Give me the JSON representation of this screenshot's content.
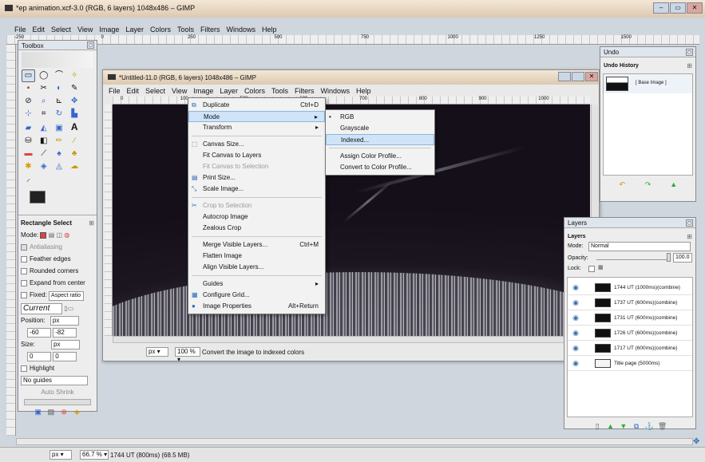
{
  "main_window": {
    "title": "*ep animation.xcf-3.0 (RGB, 6 layers) 1048x486 – GIMP",
    "menu": [
      "File",
      "Edit",
      "Select",
      "View",
      "Image",
      "Layer",
      "Colors",
      "Tools",
      "Filters",
      "Windows",
      "Help"
    ],
    "ruler_marks": [
      "-250",
      "0",
      "250",
      "500",
      "750",
      "1000",
      "1250",
      "1500"
    ],
    "status": {
      "unit": "px ▾",
      "zoom": "66.7 % ▾",
      "message": "1744 UT (800ms) (68.5 MB)"
    }
  },
  "toolbox": {
    "title": "Toolbox",
    "tool_options_title": "Rectangle Select",
    "mode_label": "Mode:",
    "antialiasing": "Antialiasing",
    "feather": "Feather edges",
    "rounded": "Rounded corners",
    "expand": "Expand from center",
    "fixed_label": "Fixed:",
    "fixed_value": "Aspect ratio",
    "current": "Current",
    "position_label": "Position:",
    "position_unit": "px",
    "pos_x": "-60",
    "pos_y": "-82",
    "size_label": "Size:",
    "size_unit": "px",
    "size_w": "0",
    "size_h": "0",
    "highlight": "Highlight",
    "guides": "No guides",
    "autoshrink": "Auto Shrink"
  },
  "untitled_window": {
    "title": "*Untitled-11.0 (RGB, 6 layers) 1048x486 – GIMP",
    "menu": [
      "File",
      "Edit",
      "Select",
      "View",
      "Image",
      "Layer",
      "Colors",
      "Tools",
      "Filters",
      "Windows",
      "Help"
    ],
    "ruler_marks": [
      "0",
      "100",
      "500",
      "600",
      "700",
      "800",
      "900",
      "1000"
    ],
    "status": {
      "unit": "px ▾",
      "zoom": "100 % ▾",
      "message": "Convert the image to indexed colors"
    }
  },
  "image_menu": {
    "items": [
      {
        "label": "Duplicate",
        "accel": "Ctrl+D",
        "icon": "duplicate-icon",
        "glyph": "⧉"
      },
      {
        "label": "Mode",
        "arrow": "▸",
        "highlight": true
      },
      {
        "label": "Transform",
        "arrow": "▸"
      },
      {
        "sep": true
      },
      {
        "label": "Canvas Size...",
        "icon": "canvas-size-icon",
        "glyph": "⬚"
      },
      {
        "label": "Fit Canvas to Layers"
      },
      {
        "label": "Fit Canvas to Selection",
        "disabled": true
      },
      {
        "label": "Print Size...",
        "icon": "print-size-icon",
        "glyph": "▤"
      },
      {
        "label": "Scale Image...",
        "icon": "scale-icon",
        "glyph": "⤡"
      },
      {
        "sep": true
      },
      {
        "label": "Crop to Selection",
        "disabled": true,
        "icon": "crop-icon",
        "glyph": "✂"
      },
      {
        "label": "Autocrop Image"
      },
      {
        "label": "Zealous Crop"
      },
      {
        "sep": true
      },
      {
        "label": "Merge Visible Layers...",
        "accel": "Ctrl+M"
      },
      {
        "label": "Flatten Image"
      },
      {
        "label": "Align Visible Layers..."
      },
      {
        "sep": true
      },
      {
        "label": "Guides",
        "arrow": "▸"
      },
      {
        "label": "Configure Grid...",
        "icon": "grid-icon",
        "glyph": "▦"
      },
      {
        "label": "Image Properties",
        "accel": "Alt+Return",
        "icon": "info-icon",
        "glyph": "●"
      }
    ]
  },
  "mode_submenu": {
    "items": [
      {
        "label": "RGB",
        "bullet": "•"
      },
      {
        "label": "Grayscale"
      },
      {
        "label": "Indexed...",
        "highlight": true
      },
      {
        "sep": true
      },
      {
        "label": "Assign Color Profile..."
      },
      {
        "label": "Convert to Color Profile..."
      }
    ]
  },
  "undo": {
    "title": "Undo",
    "history_label": "Undo History",
    "base_image": "[ Base Image ]"
  },
  "layers": {
    "title": "Layers",
    "section": "Layers",
    "mode_label": "Mode:",
    "mode_value": "Normal",
    "opacity_label": "Opacity:",
    "opacity_value": "100.0",
    "lock_label": "Lock:",
    "rows": [
      {
        "name": "1744 UT (1000ms)(combine)",
        "light": false
      },
      {
        "name": "1737 UT (600ms)(combine)",
        "light": false
      },
      {
        "name": "1731 UT (600ms)(combine)",
        "light": false
      },
      {
        "name": "1726 UT (600ms)(combine)",
        "light": false
      },
      {
        "name": "1717 UT (600ms)(combine)",
        "light": false
      },
      {
        "name": "Title page (5000ms)",
        "light": true
      }
    ]
  }
}
